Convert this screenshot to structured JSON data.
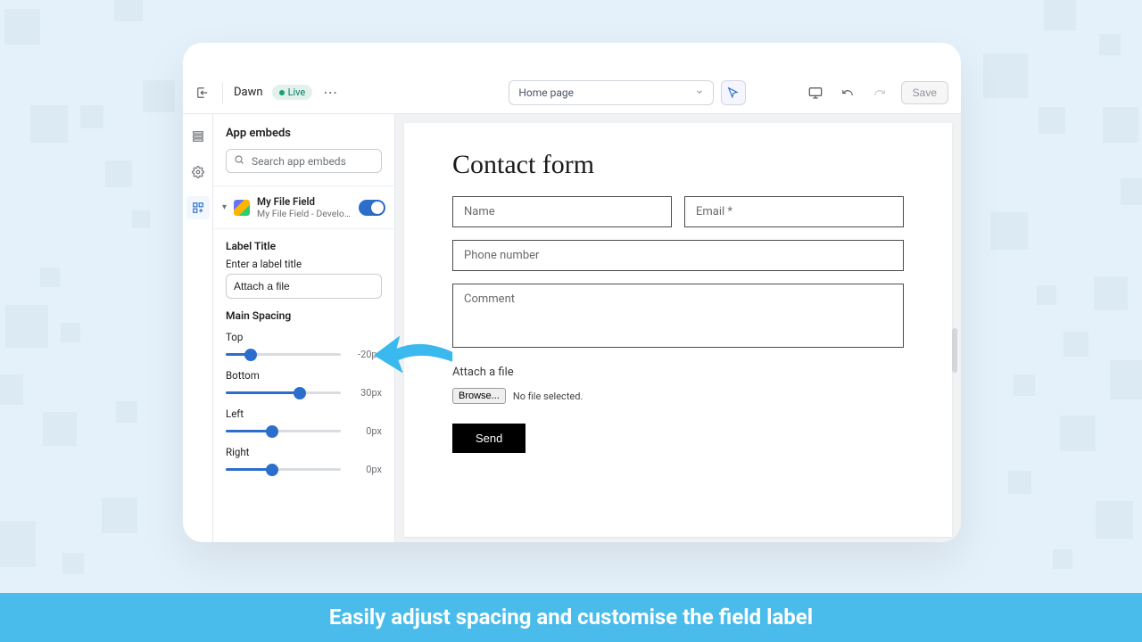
{
  "caption": "Easily adjust spacing and customise the field label",
  "topbar": {
    "theme_name": "Dawn",
    "live_label": "Live",
    "page_select": "Home page",
    "save_label": "Save"
  },
  "panel": {
    "title": "App embeds",
    "search_placeholder": "Search app embeds",
    "embed": {
      "name": "My File Field",
      "subtitle": "My File Field - Develop..."
    },
    "section_label_title": "Label Title",
    "label_title_help": "Enter a label title",
    "label_title_value": "Attach a file",
    "section_main_spacing": "Main Spacing",
    "sliders": {
      "top": {
        "name": "Top",
        "value": "-20px",
        "pct": 22
      },
      "bottom": {
        "name": "Bottom",
        "value": "30px",
        "pct": 64
      },
      "left": {
        "name": "Left",
        "value": "0px",
        "pct": 40
      },
      "right": {
        "name": "Right",
        "value": "0px",
        "pct": 40
      }
    }
  },
  "preview": {
    "form_title": "Contact form",
    "name_ph": "Name",
    "email_ph": "Email *",
    "phone_ph": "Phone number",
    "comment_ph": "Comment",
    "attach_label": "Attach a file",
    "browse_label": "Browse...",
    "no_file": "No file selected.",
    "send_label": "Send"
  }
}
